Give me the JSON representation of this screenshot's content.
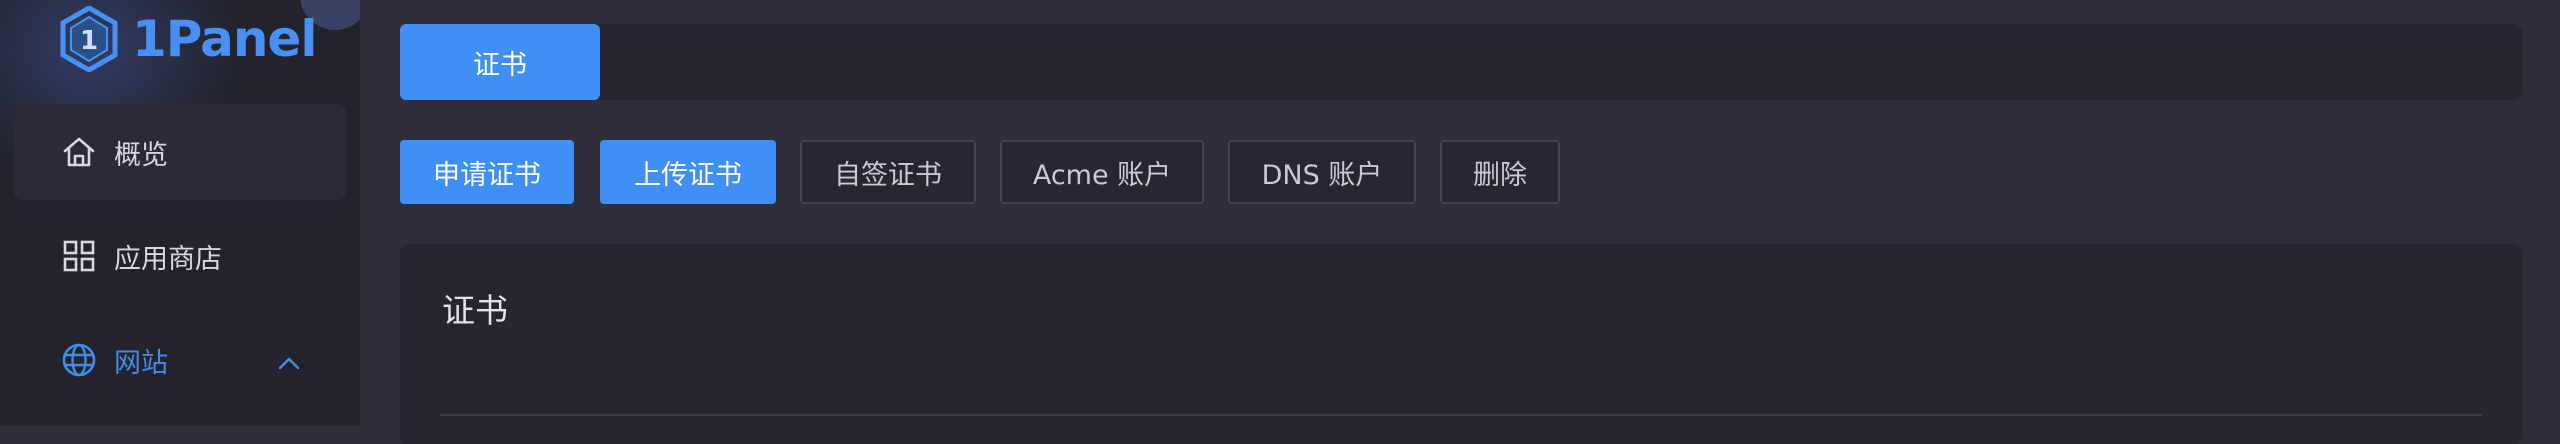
{
  "app": {
    "logo_text": "1Panel",
    "accent_color": "#3f8ff4"
  },
  "sidebar": {
    "items": [
      {
        "label": "概览",
        "icon": "home-icon",
        "active": false
      },
      {
        "label": "应用商店",
        "icon": "grid-icon",
        "active": false
      },
      {
        "label": "网站",
        "icon": "globe-icon",
        "active": true,
        "expanded": true
      }
    ]
  },
  "tabs": [
    {
      "label": "证书",
      "active": true
    }
  ],
  "toolbar": {
    "buttons": [
      {
        "label": "申请证书",
        "style": "primary"
      },
      {
        "label": "上传证书",
        "style": "primary"
      },
      {
        "label": "自签证书",
        "style": "plain"
      },
      {
        "label": "Acme 账户",
        "style": "plain"
      },
      {
        "label": "DNS 账户",
        "style": "plain"
      },
      {
        "label": "删除",
        "style": "plain"
      }
    ]
  },
  "card": {
    "title": "证书"
  }
}
